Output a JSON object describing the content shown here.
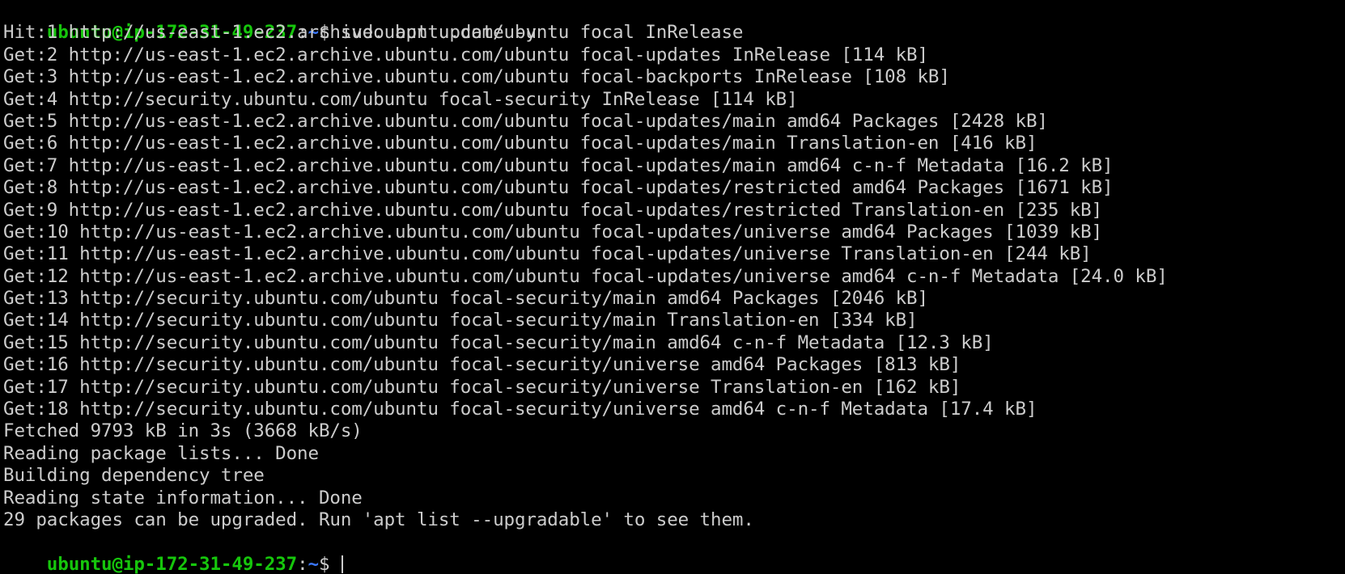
{
  "terminal": {
    "prompt": {
      "user_host": "ubuntu@ip-172-31-49-237",
      "separator": ":",
      "path": "~",
      "symbol": "$ "
    },
    "command": "sudo apt update -y",
    "output": [
      "Hit:1 http://us-east-1.ec2.archive.ubuntu.com/ubuntu focal InRelease",
      "Get:2 http://us-east-1.ec2.archive.ubuntu.com/ubuntu focal-updates InRelease [114 kB]",
      "Get:3 http://us-east-1.ec2.archive.ubuntu.com/ubuntu focal-backports InRelease [108 kB]",
      "Get:4 http://security.ubuntu.com/ubuntu focal-security InRelease [114 kB]",
      "Get:5 http://us-east-1.ec2.archive.ubuntu.com/ubuntu focal-updates/main amd64 Packages [2428 kB]",
      "Get:6 http://us-east-1.ec2.archive.ubuntu.com/ubuntu focal-updates/main Translation-en [416 kB]",
      "Get:7 http://us-east-1.ec2.archive.ubuntu.com/ubuntu focal-updates/main amd64 c-n-f Metadata [16.2 kB]",
      "Get:8 http://us-east-1.ec2.archive.ubuntu.com/ubuntu focal-updates/restricted amd64 Packages [1671 kB]",
      "Get:9 http://us-east-1.ec2.archive.ubuntu.com/ubuntu focal-updates/restricted Translation-en [235 kB]",
      "Get:10 http://us-east-1.ec2.archive.ubuntu.com/ubuntu focal-updates/universe amd64 Packages [1039 kB]",
      "Get:11 http://us-east-1.ec2.archive.ubuntu.com/ubuntu focal-updates/universe Translation-en [244 kB]",
      "Get:12 http://us-east-1.ec2.archive.ubuntu.com/ubuntu focal-updates/universe amd64 c-n-f Metadata [24.0 kB]",
      "Get:13 http://security.ubuntu.com/ubuntu focal-security/main amd64 Packages [2046 kB]",
      "Get:14 http://security.ubuntu.com/ubuntu focal-security/main Translation-en [334 kB]",
      "Get:15 http://security.ubuntu.com/ubuntu focal-security/main amd64 c-n-f Metadata [12.3 kB]",
      "Get:16 http://security.ubuntu.com/ubuntu focal-security/universe amd64 Packages [813 kB]",
      "Get:17 http://security.ubuntu.com/ubuntu focal-security/universe Translation-en [162 kB]",
      "Get:18 http://security.ubuntu.com/ubuntu focal-security/universe amd64 c-n-f Metadata [17.4 kB]",
      "Fetched 9793 kB in 3s (3668 kB/s)",
      "Reading package lists... Done",
      "Building dependency tree",
      "Reading state information... Done",
      "29 packages can be upgraded. Run 'apt list --upgradable' to see them."
    ],
    "colors": {
      "background": "#000000",
      "foreground": "#cccccc",
      "prompt_user": "#16c60c",
      "prompt_path": "#3b78ff"
    }
  }
}
